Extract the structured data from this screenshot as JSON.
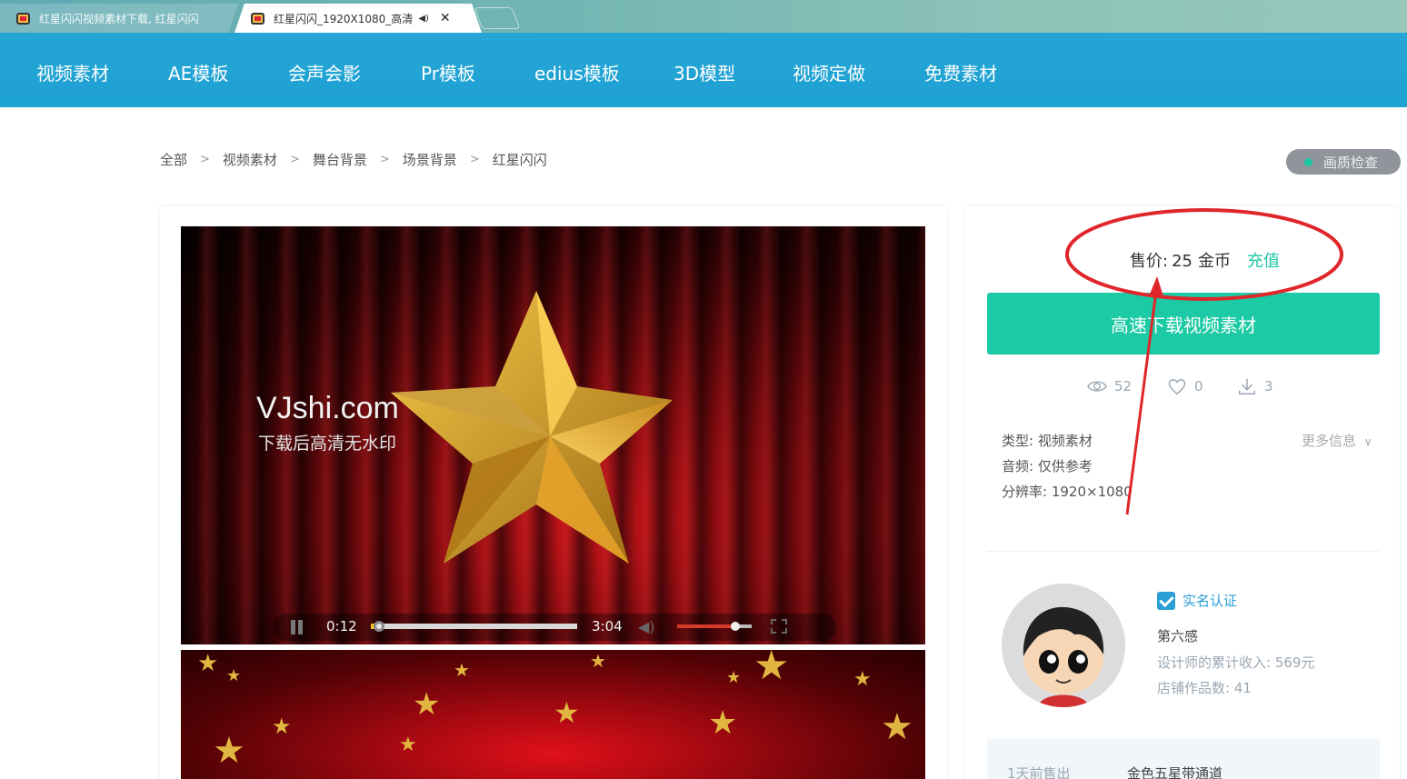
{
  "browser": {
    "tabs": [
      {
        "title": "红星闪闪视频素材下载, 红星闪闪",
        "active": false
      },
      {
        "title": "红星闪闪_1920X1080_高清",
        "active": true
      }
    ],
    "audio_icon": "speaker-icon",
    "close_symbol": "✕"
  },
  "nav": {
    "items": [
      "视频素材",
      "AE模板",
      "会声会影",
      "Pr模板",
      "edius模板",
      "3D模型",
      "视频定做",
      "免费素材"
    ]
  },
  "breadcrumb": {
    "items": [
      "全部",
      "视频素材",
      "舞台背景",
      "场景背景",
      "红星闪闪"
    ],
    "separator": ">"
  },
  "quality_check": {
    "label": "画质检查"
  },
  "player": {
    "watermark": "VJshi.com",
    "watermark_sub": "下载后高清无水印",
    "current_time": "0:12",
    "duration": "3:04",
    "progress": 0.04,
    "volume": 0.78
  },
  "purchase": {
    "price_label": "售价:",
    "price_value": "25",
    "price_unit": "金币",
    "recharge": "充值",
    "download_button": "高速下载视频素材"
  },
  "stats": {
    "views": "52",
    "likes": "0",
    "downloads": "3"
  },
  "info": {
    "type": "类型: 视频素材",
    "audio": "音频: 仅供参考",
    "resolution": "分辨率: 1920×1080",
    "more": "更多信息"
  },
  "designer": {
    "verified": "实名认证",
    "name": "第六感",
    "income": "设计师的累计收入: 569元",
    "works": "店铺作品数: 41"
  },
  "recent_sale": {
    "time": "1天前售出",
    "item": "金色五星带通道"
  },
  "colors": {
    "nav_bg": "#1ea2d3",
    "accent_green": "#1ccaa5",
    "annotation_red": "#e0262b",
    "verified_blue": "#2a9fd6"
  }
}
